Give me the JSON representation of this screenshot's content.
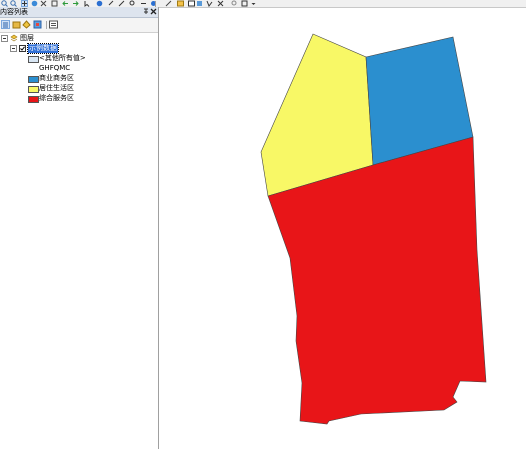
{
  "toc": {
    "title": "内容列表",
    "root_label": "图层",
    "layer_label": "示例数据",
    "other_values_label": "<其他所有值>",
    "field_name": "GHFQMC",
    "legend": [
      {
        "label": "商业商务区",
        "color": "#2b8fcf"
      },
      {
        "label": "居住生活区",
        "color": "#f8f866"
      },
      {
        "label": "综合服务区",
        "color": "#e81518"
      }
    ],
    "other_values_color": "#d8e6f4"
  },
  "map": {
    "zones": [
      {
        "name": "居住生活区",
        "color": "#f8f866"
      },
      {
        "name": "商业商务区",
        "color": "#2b8fcf"
      },
      {
        "name": "综合服务区",
        "color": "#e81518"
      }
    ]
  }
}
